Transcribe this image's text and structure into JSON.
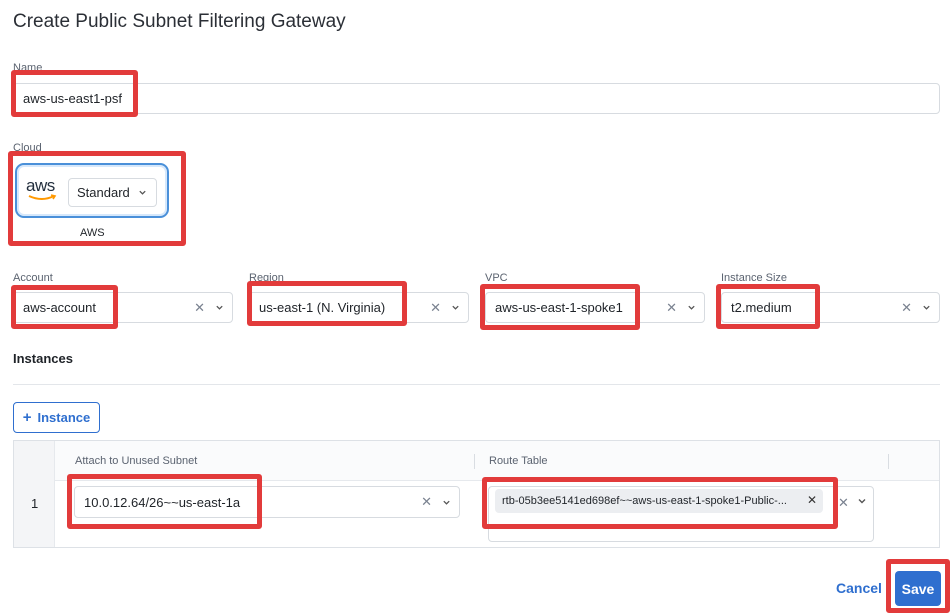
{
  "page": {
    "title": "Create Public Subnet Filtering Gateway"
  },
  "name_field": {
    "label": "Name",
    "value": "aws-us-east1-psf"
  },
  "cloud": {
    "label": "Cloud",
    "provider_logo": "aws",
    "provider_name": "AWS",
    "edition": "Standard"
  },
  "account": {
    "label": "Account",
    "value": "aws-account"
  },
  "region": {
    "label": "Region",
    "value": "us-east-1 (N. Virginia)"
  },
  "vpc": {
    "label": "VPC",
    "value": "aws-us-east-1-spoke1"
  },
  "instance_size": {
    "label": "Instance Size",
    "value": "t2.medium"
  },
  "instances": {
    "section_title": "Instances",
    "add_button": "Instance",
    "columns": [
      "Attach to Unused Subnet",
      "Route Table"
    ],
    "rows": [
      {
        "index": "1",
        "subnet": "10.0.12.64/26~~us-east-1a",
        "route_table": "rtb-05b3ee5141ed698ef~~aws-us-east-1-spoke1-Public-..."
      }
    ]
  },
  "actions": {
    "cancel": "Cancel",
    "save": "Save"
  },
  "colors": {
    "accent": "#2f6fcf",
    "highlight": "#e23b3b"
  },
  "icons": [
    "clear-icon",
    "chevron-down-icon",
    "plus-icon",
    "aws-logo"
  ]
}
